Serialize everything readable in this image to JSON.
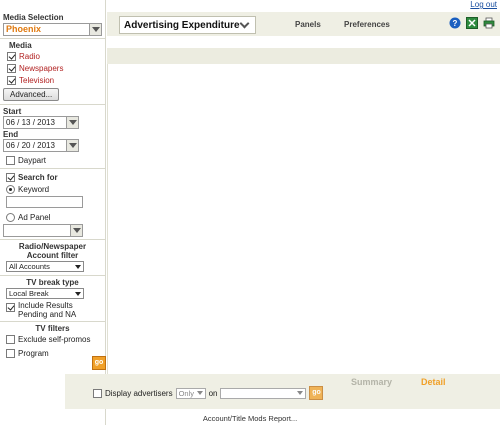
{
  "header": {
    "logout": "Log out",
    "report": "Advertising Expenditure",
    "panels": "Panels",
    "preferences": "Preferences"
  },
  "sidebar": {
    "media_selection_label": "Media Selection",
    "market": "Phoenix",
    "media_label": "Media",
    "media": [
      {
        "label": "Radio",
        "checked": true
      },
      {
        "label": "Newspapers",
        "checked": true
      },
      {
        "label": "Television",
        "checked": true
      }
    ],
    "advanced_button": "Advanced...",
    "start_label": "Start",
    "start_date": "06 / 13 / 2013",
    "end_label": "End",
    "end_date": "06 / 20 / 2013",
    "daypart": "Daypart",
    "search_for": "Search for",
    "keyword": "Keyword",
    "ad_panel": "Ad Panel",
    "radio_newspaper": "Radio/Newspaper",
    "account_filter": "Account filter",
    "account_value": "All Accounts",
    "tv_break_type": "TV break type",
    "break_value": "Local Break",
    "include_results": "Include Results Pending and NA",
    "tv_filters": "TV filters",
    "exclude_promos": "Exclude self-promos",
    "program": "Program",
    "go": "go"
  },
  "bottom": {
    "display_advertisers": "Display advertisers",
    "only": "Only",
    "on": "on",
    "go": "go",
    "tab_summary": "Summary",
    "tab_detail": "Detail"
  },
  "footer": {
    "report_link": "Account/Title Mods Report..."
  },
  "colors": {
    "accent_orange": "#f0a028",
    "link_blue": "#1a4fa0",
    "media_red": "#b22222",
    "panel_beige": "#efefe4"
  }
}
